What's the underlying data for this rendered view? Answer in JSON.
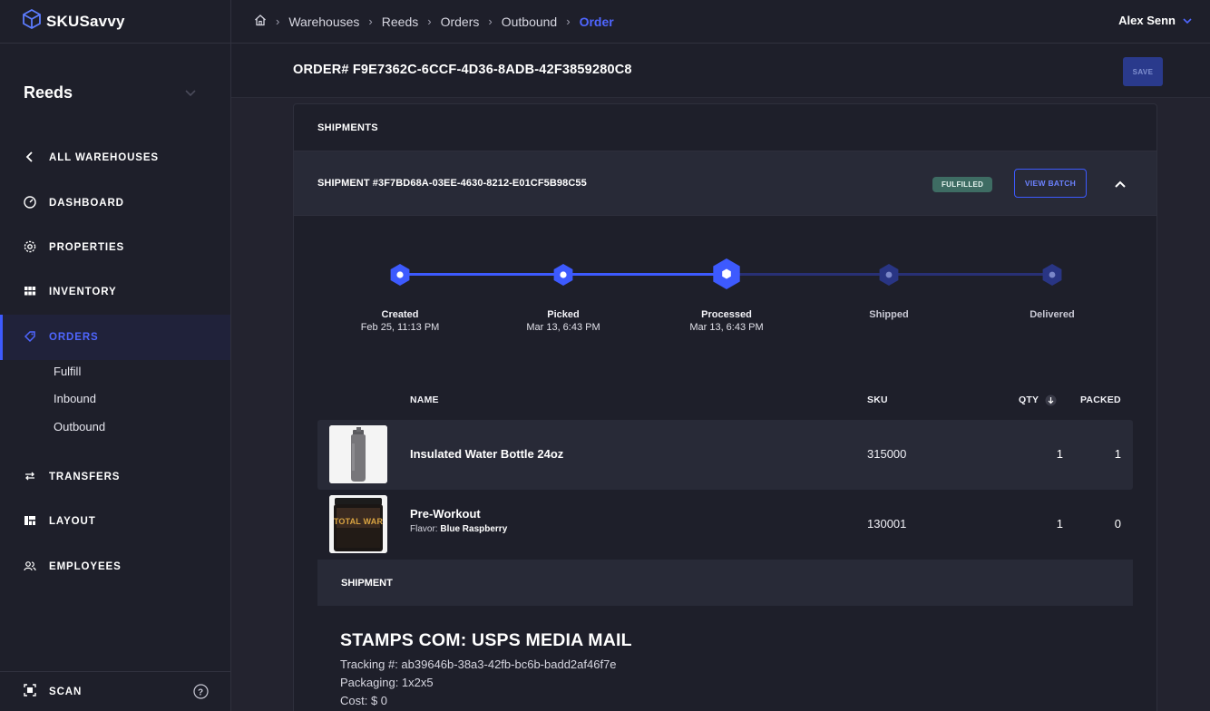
{
  "app": {
    "brand": "SKUSavvy"
  },
  "sidebar": {
    "warehouse": "Reeds",
    "items": [
      {
        "label": "ALL WAREHOUSES",
        "icon": "chevron-left-icon"
      },
      {
        "label": "DASHBOARD",
        "icon": "gauge-icon"
      },
      {
        "label": "PROPERTIES",
        "icon": "gear-icon"
      },
      {
        "label": "INVENTORY",
        "icon": "grid-icon"
      },
      {
        "label": "ORDERS",
        "icon": "tag-icon"
      },
      {
        "label": "TRANSFERS",
        "icon": "arrows-icon"
      },
      {
        "label": "LAYOUT",
        "icon": "layout-icon"
      },
      {
        "label": "EMPLOYEES",
        "icon": "users-icon"
      }
    ],
    "subitems": [
      "Fulfill",
      "Inbound",
      "Outbound"
    ],
    "scan_label": "SCAN"
  },
  "topbar": {
    "breadcrumbs": [
      "Warehouses",
      "Reeds",
      "Orders",
      "Outbound",
      "Order"
    ],
    "user_name": "Alex Senn"
  },
  "order": {
    "title": "ORDER# F9E7362C-6CCF-4D36-8ADB-42F3859280C8",
    "save_label": "SAVE"
  },
  "shipments": {
    "heading": "SHIPMENTS",
    "shipment_id": "SHIPMENT #3F7BD68A-03EE-4630-8212-E01CF5B98C55",
    "status": "FULFILLED",
    "view_batch_label": "VIEW BATCH",
    "steps": [
      {
        "label": "Created",
        "date": "Feb 25, 11:13 PM",
        "state": "done"
      },
      {
        "label": "Picked",
        "date": "Mar 13, 6:43 PM",
        "state": "done"
      },
      {
        "label": "Processed",
        "date": "Mar 13, 6:43 PM",
        "state": "current"
      },
      {
        "label": "Shipped",
        "date": "",
        "state": "pending"
      },
      {
        "label": "Delivered",
        "date": "",
        "state": "pending"
      }
    ],
    "columns": {
      "name": "NAME",
      "sku": "SKU",
      "qty": "QTY",
      "packed": "PACKED"
    },
    "items": [
      {
        "name": "Insulated Water Bottle 24oz",
        "variant_label": "",
        "variant_value": "",
        "sku": "315000",
        "qty": "1",
        "packed": "1"
      },
      {
        "name": "Pre-Workout",
        "variant_label": "Flavor:",
        "variant_value": "Blue Raspberry",
        "sku": "130001",
        "qty": "1",
        "packed": "0",
        "image_text": "TOTAL WAR"
      }
    ],
    "shipment_section": {
      "heading": "SHIPMENT",
      "carrier": "STAMPS COM: USPS MEDIA MAIL",
      "tracking": "Tracking #: ab39646b-38a3-42fb-bc6b-badd2af46f7e",
      "packaging": "Packaging: 1x2x5",
      "cost": "Cost: $ 0"
    }
  },
  "colors": {
    "accent": "#3d5afe",
    "badge": "#3e6c63",
    "background": "#23232f"
  }
}
